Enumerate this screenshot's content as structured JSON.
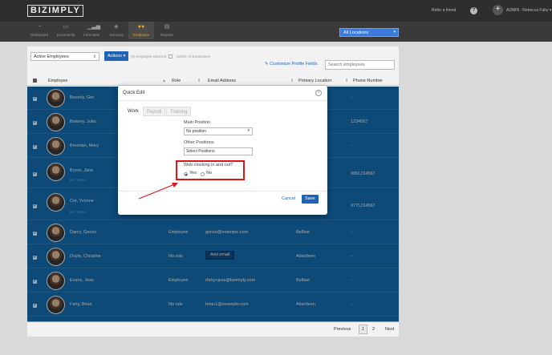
{
  "header": {
    "logo": "BIZIMPLY",
    "refer": "Refer a friend",
    "help_glyph": "?",
    "plus_glyph": "+",
    "user": "ADMIN : Rebecca Fahy ▾"
  },
  "nav": {
    "items": [
      {
        "label": "Dashboard",
        "icon": "dashboard-icon"
      },
      {
        "label": "Documents",
        "icon": "documents-icon"
      },
      {
        "label": "Forecasts",
        "icon": "forecasts-icon"
      },
      {
        "label": "Services",
        "icon": "services-icon"
      },
      {
        "label": "Employee",
        "icon": "employee-icon",
        "active": true
      },
      {
        "label": "Reports",
        "icon": "reports-icon"
      }
    ],
    "location_select": "All Locations"
  },
  "toolbar": {
    "filter": "Active Employees",
    "actions": "Actions ▾",
    "selected": "(0) employee selected",
    "select_all": "Select All Employees",
    "customize": "Customize Profile Fields",
    "search_placeholder": "Search employees"
  },
  "table": {
    "headers": {
      "employee": "Employee",
      "role": "Role",
      "email": "Email Address",
      "location": "Primary Location",
      "phone": "Phone Number"
    },
    "rows": [
      {
        "name": "Beverly, Ger",
        "tag": "",
        "role": "",
        "email": "",
        "location": "",
        "phone": "-"
      },
      {
        "name": "Bowery, Julia",
        "tag": "",
        "role": "",
        "email": "",
        "location": "",
        "phone": "1234567"
      },
      {
        "name": "Brennan, Mary",
        "tag": "",
        "role": "",
        "email": "",
        "location": "",
        "phone": "-"
      },
      {
        "name": "Bryon, Jane",
        "tag": "KEY STAFF",
        "role": "",
        "email": "",
        "location": "",
        "phone": "0861234567"
      },
      {
        "name": "Cor, Yvonne",
        "tag": "KEY STAFF",
        "role": "",
        "email": "",
        "location": "",
        "phone": "0771234567"
      },
      {
        "name": "Darcy, Gonzo",
        "tag": "",
        "role": "Employee",
        "email": "gonzo@example.com",
        "location": "Belfast",
        "phone": "-"
      },
      {
        "name": "Doyle, Christine",
        "tag": "",
        "role": "No role",
        "email": "",
        "location": "Aberdeen",
        "phone": "-"
      },
      {
        "name": "Evans, Jess",
        "tag": "",
        "role": "Employee",
        "email": "rfahy+jess@bizimply.com",
        "location": "Belfast",
        "phone": "-"
      },
      {
        "name": "Fahy, Brian",
        "tag": "",
        "role": "No role",
        "email": "brian1@example.com",
        "location": "Aberdeen",
        "phone": "-"
      }
    ],
    "add_email": "Add email"
  },
  "pager": {
    "previous": "Previous",
    "page1": "1",
    "page2": "2",
    "next": "Next"
  },
  "modal": {
    "title": "Quick Edit",
    "close_glyph": "×",
    "tabs": [
      "Work",
      "Payroll",
      "Training"
    ],
    "main_position_label": "Main Position",
    "main_position_value": "No position",
    "other_positions_label": "Other Positions",
    "other_positions_placeholder": "Select Positions",
    "web_clocking_label": "Web clocking in and out?",
    "yes": "Yes",
    "no": "No",
    "cancel": "Cancel",
    "save": "Save"
  },
  "colors": {
    "row_blue": "#1572b8",
    "brand_blue": "#1f63b5",
    "highlight_red": "#e0141c",
    "nav_active": "#e8a33a"
  }
}
